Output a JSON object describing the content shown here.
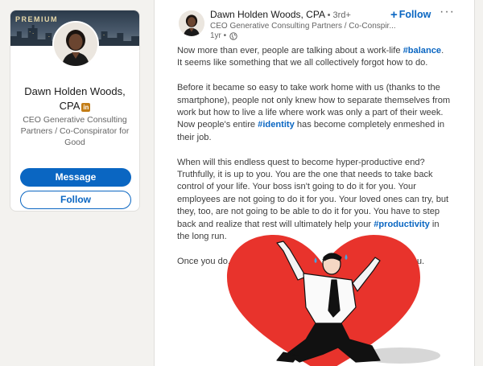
{
  "profile_card": {
    "premium_label": "PREMIUM",
    "name": "Dawn Holden Woods, CPA",
    "linkedin_badge": "in",
    "headline": "CEO Generative Consulting Partners / Co-Conspirator for Good",
    "message_label": "Message",
    "follow_label": "Follow"
  },
  "post": {
    "author_name": "Dawn Holden Woods, CPA",
    "degree": "• 3rd+",
    "author_headline": "CEO Generative Consulting Partners / Co-Conspir...",
    "age": "1yr •",
    "follow_label": "Follow",
    "more_label": "···",
    "paragraphs": {
      "p1_a": "Now more than ever, people are talking about a work-life ",
      "p1_tag": "#balance",
      "p1_b": ". It seems like something that we all collectively forgot how to do.",
      "p2_a": "Before it became so easy to take work home with us (thanks to the smartphone), people not only knew how to separate themselves from work but how to live a life where work was only a part of their week. Now people's entire ",
      "p2_tag": "#identity",
      "p2_b": " has become completely enmeshed in their job.",
      "p3_a": "When will this endless quest to become hyper-productive end? Truthfully, it is up to you. You are the one that needs to take back control of your life. Your boss isn't going to do it for you. Your employees are not going to do it for you. Your loved ones can try, but they, too, are not going to be able to do it for you. You have to step back and realize that rest will ultimately help your ",
      "p3_tag": "#productivity",
      "p3_b": " in the long run.",
      "p4": "Once you do, you will be happy with the results, I promise you."
    }
  },
  "colors": {
    "accent": "#0a66c2",
    "heart": "#e8332c",
    "linkedin_gold": "#c37d16"
  }
}
